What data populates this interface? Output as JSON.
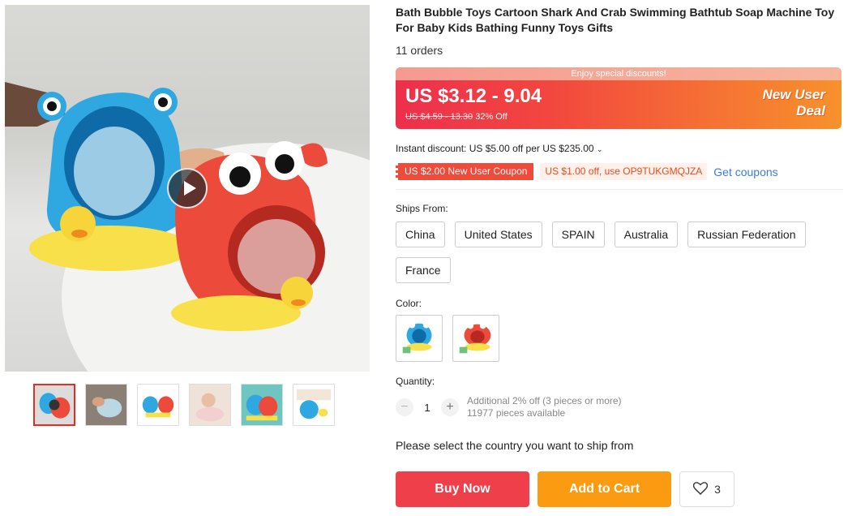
{
  "product": {
    "title": "Bath Bubble Toys Cartoon Shark And Crab Swimming Bathtub Soap Machine Toy For Baby Kids Bathing Funny Toys Gifts",
    "orders": "11 orders"
  },
  "price": {
    "banner_note": "Enjoy special discounts!",
    "range": "US $3.12 - 9.04",
    "original": "US $4.59 - 13.30",
    "discount": "32% Off",
    "deal_line1": "New User",
    "deal_line2": "Deal"
  },
  "promo": {
    "instant_discount": "Instant discount: US $5.00 off per US $235.00",
    "coupon_new_user": "US $2.00 New User Coupon",
    "coupon_code": "US $1.00 off, use OP9TUKGMQJZA",
    "get_coupons": "Get coupons"
  },
  "shipping": {
    "label": "Ships From:",
    "options": [
      "China",
      "United States",
      "SPAIN",
      "Australia",
      "Russian Federation",
      "France"
    ]
  },
  "color": {
    "label": "Color:",
    "options": [
      "shark-blue",
      "crab-red"
    ]
  },
  "quantity": {
    "label": "Quantity:",
    "value": "1",
    "minus": "−",
    "plus": "+",
    "note_discount": "Additional 2% off (3 pieces or more)",
    "note_stock": "11977 pieces available"
  },
  "ship_prompt": "Please select the country you want to ship from",
  "actions": {
    "buy_now": "Buy Now",
    "add_to_cart": "Add to Cart",
    "wish_count": "3"
  },
  "colors": {
    "accent_red": "#ee3f4a",
    "accent_orange": "#fb9b12",
    "link_blue": "#3a7dd4"
  },
  "icons": [
    "play-icon",
    "chevron-down-icon",
    "heart-icon"
  ]
}
